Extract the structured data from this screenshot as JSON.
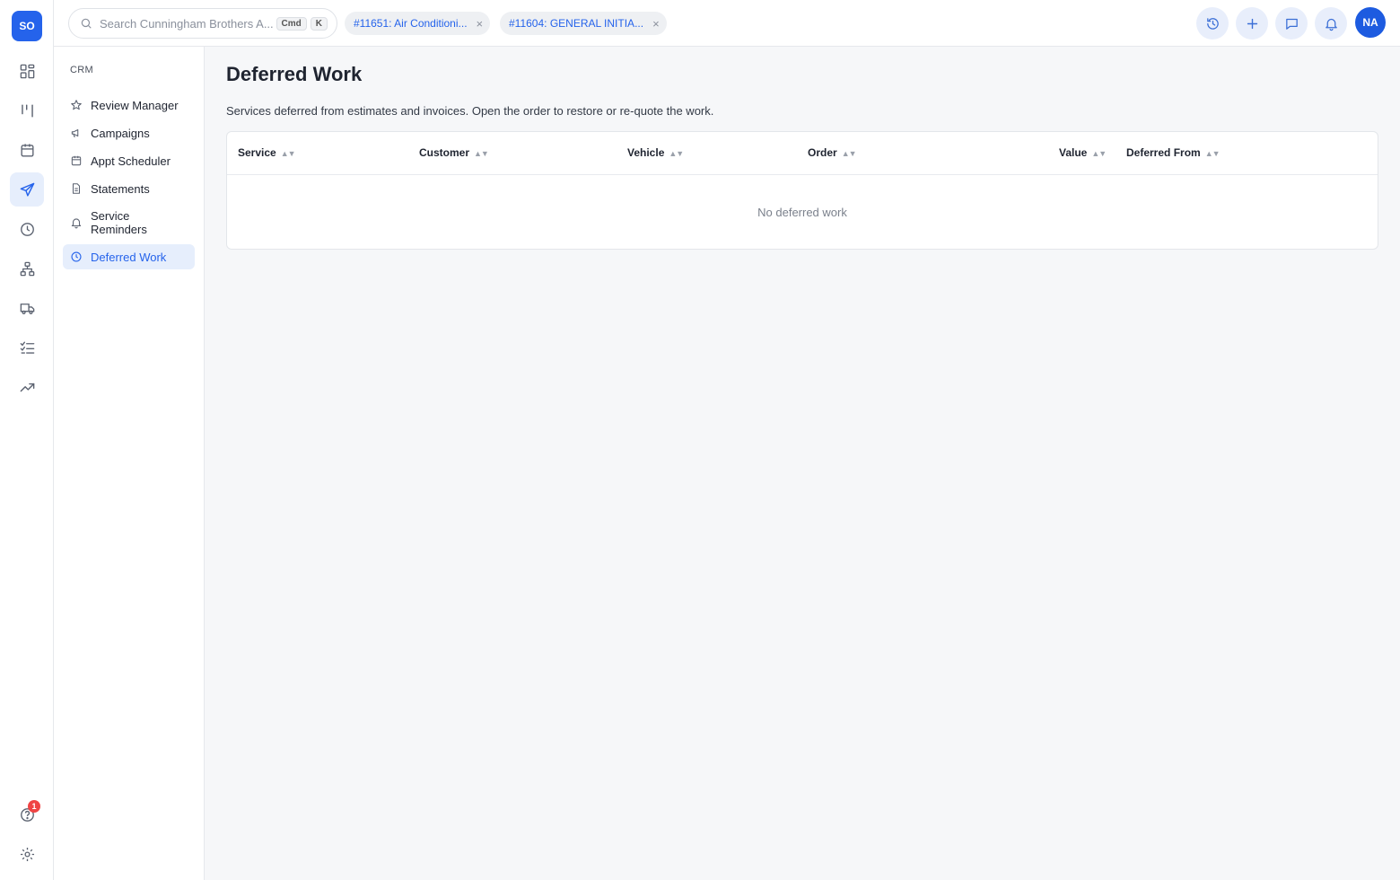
{
  "rail": {
    "logo": "SO",
    "help_badge": "1",
    "items": [
      "dashboard-icon",
      "workflow-icon",
      "calendar-icon",
      "send-icon",
      "clock-icon",
      "org-chart-icon",
      "truck-icon",
      "checklist-icon",
      "trending-up-icon",
      "help-icon",
      "settings-icon"
    ]
  },
  "topbar": {
    "search_placeholder": "Search Cunningham Brothers A...",
    "kbd_cmd": "Cmd",
    "kbd_k": "K",
    "tabs": [
      {
        "label": "#11651: Air Conditioni..."
      },
      {
        "label": "#11604: GENERAL INITIA..."
      }
    ],
    "avatar": "NA"
  },
  "subnav": {
    "title": "CRM",
    "items": [
      {
        "label": "Review Manager",
        "icon": "star-icon"
      },
      {
        "label": "Campaigns",
        "icon": "megaphone-icon"
      },
      {
        "label": "Appt Scheduler",
        "icon": "calendar-icon"
      },
      {
        "label": "Statements",
        "icon": "document-icon"
      },
      {
        "label": "Service Reminders",
        "icon": "bell-icon"
      },
      {
        "label": "Deferred Work",
        "icon": "clock-icon",
        "active": true
      }
    ]
  },
  "main": {
    "title": "Deferred Work",
    "subtitle": "Services deferred from estimates and invoices. Open the order to restore or re-quote the work.",
    "columns": [
      "Service",
      "Customer",
      "Vehicle",
      "Order",
      "Value",
      "Deferred From"
    ],
    "sort_glyph": "▲▼",
    "empty_text": "No deferred work"
  },
  "colors": {
    "accent": "#2563eb",
    "active_bg": "#e6eefc",
    "badge": "#ef4444",
    "background": "#f6f7f9"
  }
}
